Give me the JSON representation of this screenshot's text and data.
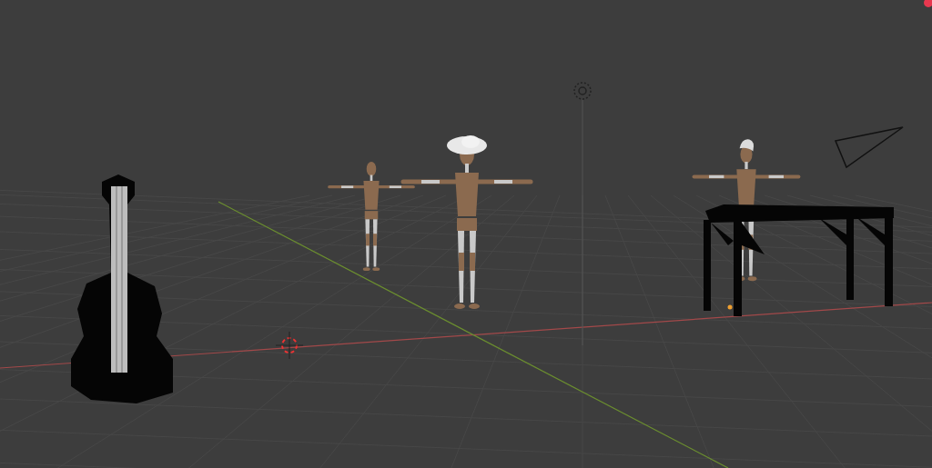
{
  "viewport": {
    "objects": [
      {
        "kind": "guitar"
      },
      {
        "kind": "mannequin",
        "hat": false,
        "hair": false
      },
      {
        "kind": "mannequin",
        "hat": true,
        "hair": false
      },
      {
        "kind": "mannequin",
        "hat": false,
        "hair": true
      },
      {
        "kind": "table"
      },
      {
        "kind": "camera"
      },
      {
        "kind": "light"
      },
      {
        "kind": "cursor"
      }
    ]
  }
}
